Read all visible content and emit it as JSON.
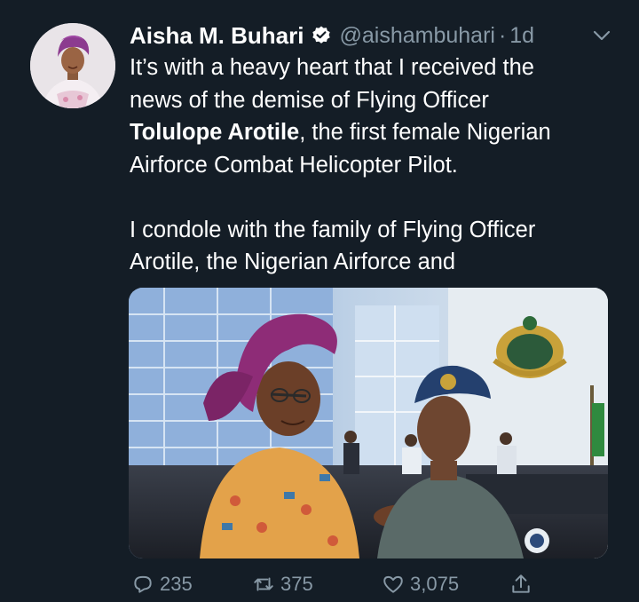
{
  "tweet": {
    "display_name": "Aisha M. Buhari",
    "handle": "@aishambuhari",
    "separator": "·",
    "time": "1d",
    "verified_icon": "verified-badge-icon",
    "menu_icon": "chevron-down-icon",
    "text": {
      "line1": "It’s with a heavy heart that I received the",
      "line2": "news of the demise of Flying Officer",
      "line3_bold": "Tolulope Arotile",
      "line3_rest": ", the first female Nigerian",
      "line4": "Airforce Combat Helicopter Pilot.",
      "line5": "I condole with the family of Flying Officer",
      "line6": "Arotile, the Nigerian Airforce and"
    }
  },
  "actions": {
    "reply_count": "235",
    "retweet_count": "375",
    "like_count": "3,075",
    "reply_icon": "reply-icon",
    "retweet_icon": "retweet-icon",
    "like_icon": "heart-icon",
    "share_icon": "share-icon"
  },
  "colors": {
    "background": "#141d26",
    "text_primary": "#ffffff",
    "text_secondary": "#8899a6",
    "verified_badge": "#ffffff"
  }
}
